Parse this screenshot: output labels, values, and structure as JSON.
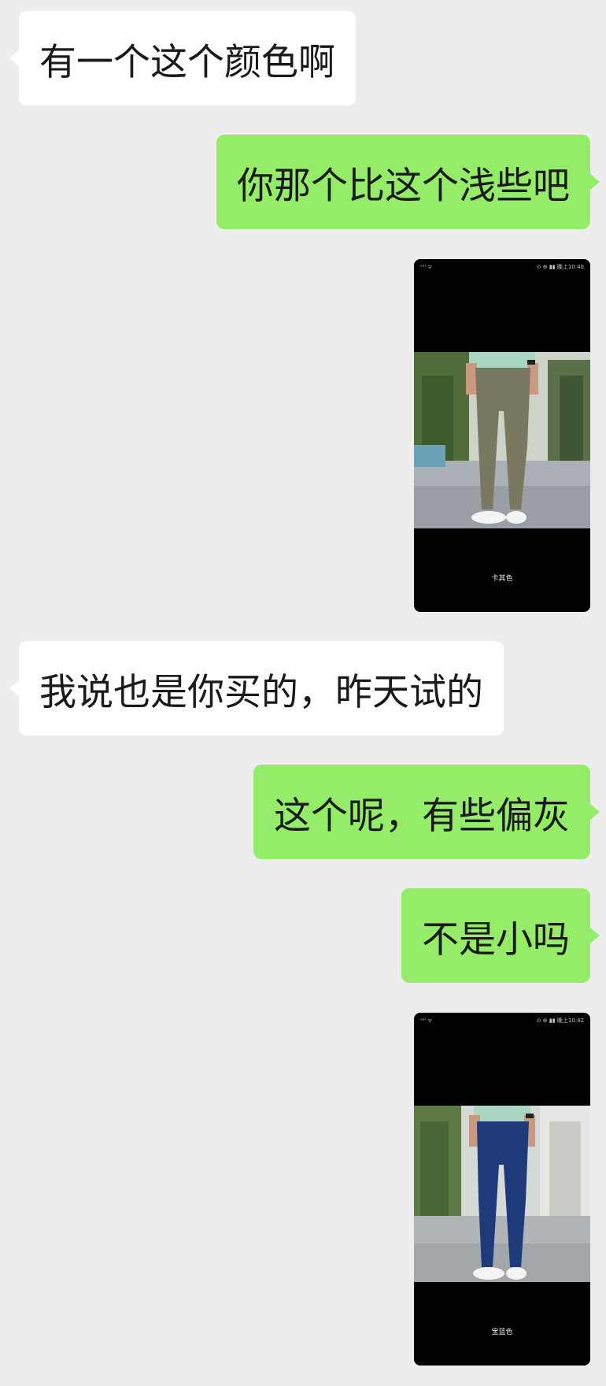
{
  "messages": [
    {
      "side": "left",
      "type": "text",
      "text": "有一个这个颜色啊"
    },
    {
      "side": "right",
      "type": "text",
      "text": "你那个比这个浅些吧"
    },
    {
      "side": "right",
      "type": "image",
      "status_left": "ᵛᵃˡ ᯤ",
      "status_right": "⊙ ⊕ ▮▮ 晚上10:40",
      "caption": "卡其色",
      "pants_color": "#7b7862"
    },
    {
      "side": "left",
      "type": "text",
      "text": "我说也是你买的，昨天试的"
    },
    {
      "side": "right",
      "type": "text",
      "text": "这个呢，有些偏灰"
    },
    {
      "side": "right",
      "type": "text",
      "text": "不是小吗"
    },
    {
      "side": "right",
      "type": "image",
      "status_left": "ᵛᵃˡ ᯤ",
      "status_right": "⊙ ⊕ ▮▮ 晚上10:42",
      "caption": "宝蓝色",
      "pants_color": "#1f3a7a"
    }
  ],
  "colors": {
    "background": "#ededed",
    "incoming_bubble": "#ffffff",
    "outgoing_bubble": "#95ec69"
  }
}
